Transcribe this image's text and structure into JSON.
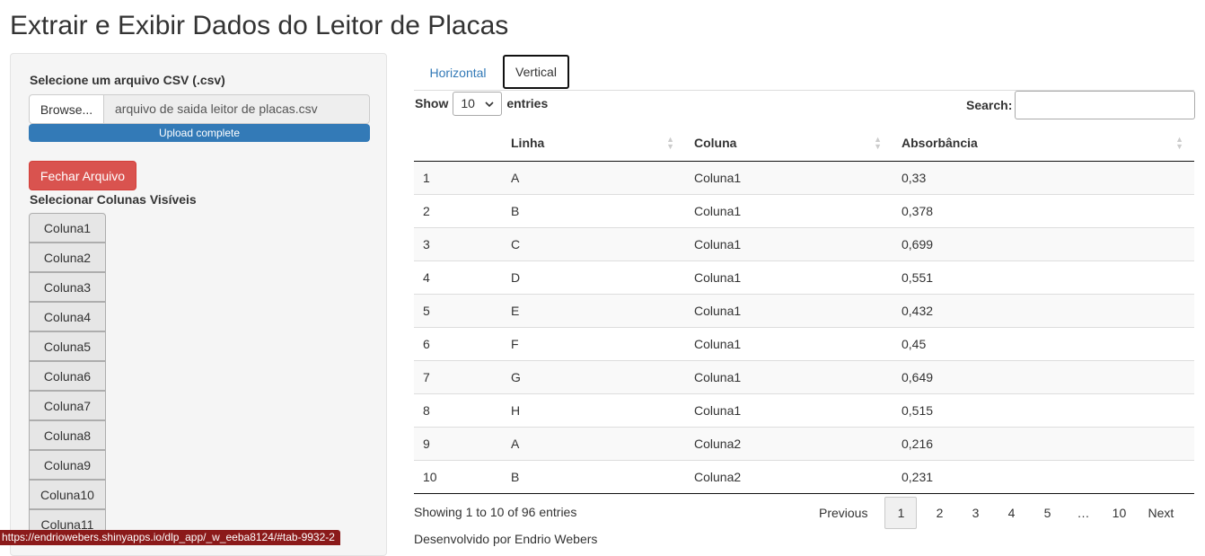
{
  "header": {
    "title": "Extrair e Exibir Dados do Leitor de Placas"
  },
  "sidebar": {
    "file_label": "Selecione um arquivo CSV (.csv)",
    "browse_label": "Browse...",
    "file_name": "arquivo de saida leitor de placas.csv",
    "progress_text": "Upload complete",
    "progress_fraction": 1.0,
    "close_file_label": "Fechar Arquivo",
    "columns_label": "Selecionar Colunas Visíveis",
    "column_buttons": [
      "Coluna1",
      "Coluna2",
      "Coluna3",
      "Coluna4",
      "Coluna5",
      "Coluna6",
      "Coluna7",
      "Coluna8",
      "Coluna9",
      "Coluna10",
      "Coluna11"
    ]
  },
  "tabs": [
    {
      "label": "Horizontal",
      "active": false
    },
    {
      "label": "Vertical",
      "active": true
    }
  ],
  "table_controls": {
    "show_label": "Show",
    "length_value": "10",
    "entries_label": "entries",
    "search_label": "Search:",
    "search_value": ""
  },
  "table": {
    "headers": [
      "",
      "Linha",
      "Coluna",
      "Absorbância"
    ],
    "rows": [
      [
        "1",
        "A",
        "Coluna1",
        "0,33"
      ],
      [
        "2",
        "B",
        "Coluna1",
        "0,378"
      ],
      [
        "3",
        "C",
        "Coluna1",
        "0,699"
      ],
      [
        "4",
        "D",
        "Coluna1",
        "0,551"
      ],
      [
        "5",
        "E",
        "Coluna1",
        "0,432"
      ],
      [
        "6",
        "F",
        "Coluna1",
        "0,45"
      ],
      [
        "7",
        "G",
        "Coluna1",
        "0,649"
      ],
      [
        "8",
        "H",
        "Coluna1",
        "0,515"
      ],
      [
        "9",
        "A",
        "Coluna2",
        "0,216"
      ],
      [
        "10",
        "B",
        "Coluna2",
        "0,231"
      ]
    ]
  },
  "footer": {
    "info": "Showing 1 to 10 of 96 entries",
    "pagination": {
      "previous": "Previous",
      "pages": [
        "1",
        "2",
        "3",
        "4",
        "5"
      ],
      "ellipsis": "…",
      "last": "10",
      "next": "Next",
      "current": "1"
    },
    "credit": "Desenvolvido por Endrio Webers"
  },
  "status_bar": {
    "url": "https://endriowebers.shinyapps.io/dlp_app/_w_eeba8124/#tab-9932-2"
  },
  "colors": {
    "accent": "#337ab7",
    "danger": "#d9534f",
    "sidebar_bg": "#f5f5f5"
  }
}
